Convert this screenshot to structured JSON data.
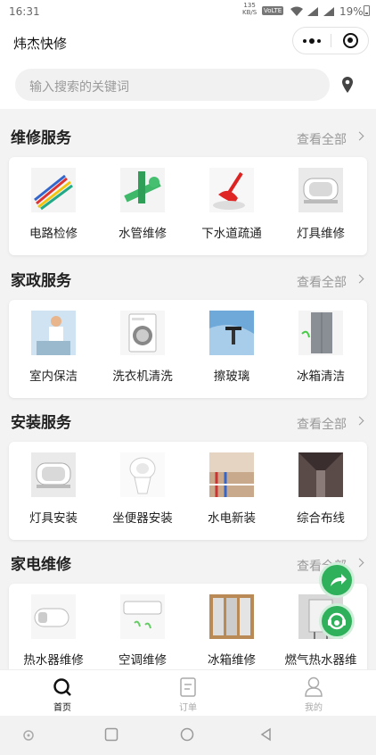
{
  "status_bar": {
    "time": "16:31",
    "net_speed_value": "135",
    "net_speed_unit": "KB/S",
    "volte": "VoLTE",
    "battery": "19%"
  },
  "nav": {
    "title": "炜杰快修",
    "more_icon": "more-icon",
    "close_icon": "target-icon"
  },
  "search": {
    "placeholder": "输入搜索的关键词",
    "location_icon": "location-pin-icon"
  },
  "sections": [
    {
      "title": "维修服务",
      "more": "查看全部",
      "items": [
        {
          "label": "电路检修",
          "icon": "wires-image"
        },
        {
          "label": "水管维修",
          "icon": "pipes-image"
        },
        {
          "label": "下水道疏通",
          "icon": "plunger-image"
        },
        {
          "label": "灯具维修",
          "icon": "ceiling-lamp-image"
        }
      ]
    },
    {
      "title": "家政服务",
      "more": "查看全部",
      "items": [
        {
          "label": "室内保洁",
          "icon": "cleaner-image"
        },
        {
          "label": "洗衣机清洗",
          "icon": "washing-machine-image"
        },
        {
          "label": "擦玻璃",
          "icon": "window-wiper-image"
        },
        {
          "label": "冰箱清洁",
          "icon": "fridge-image"
        }
      ]
    },
    {
      "title": "安装服务",
      "more": "查看全部",
      "items": [
        {
          "label": "灯具安装",
          "icon": "ceiling-lamp-image"
        },
        {
          "label": "坐便器安装",
          "icon": "toilet-image"
        },
        {
          "label": "水电新装",
          "icon": "wall-pipes-image"
        },
        {
          "label": "综合布线",
          "icon": "cable-rack-image"
        }
      ]
    },
    {
      "title": "家电维修",
      "more": "查看全部",
      "items": [
        {
          "label": "热水器维修",
          "icon": "water-heater-image"
        },
        {
          "label": "空调维修",
          "icon": "air-conditioner-image"
        },
        {
          "label": "冰箱维修",
          "icon": "fridge-repair-image"
        },
        {
          "label": "燃气热水器维",
          "icon": "gas-heater-image"
        }
      ]
    }
  ],
  "floating_buttons": [
    "share-icon",
    "customer-service-icon"
  ],
  "tabbar": {
    "tabs": [
      {
        "label": "首页",
        "icon": "search-home-icon",
        "active": true
      },
      {
        "label": "订单",
        "icon": "order-icon",
        "active": false
      },
      {
        "label": "我的",
        "icon": "person-icon",
        "active": false
      }
    ]
  },
  "colors": {
    "accent_green": "#2fb05a",
    "background": "#f3f3f3"
  }
}
